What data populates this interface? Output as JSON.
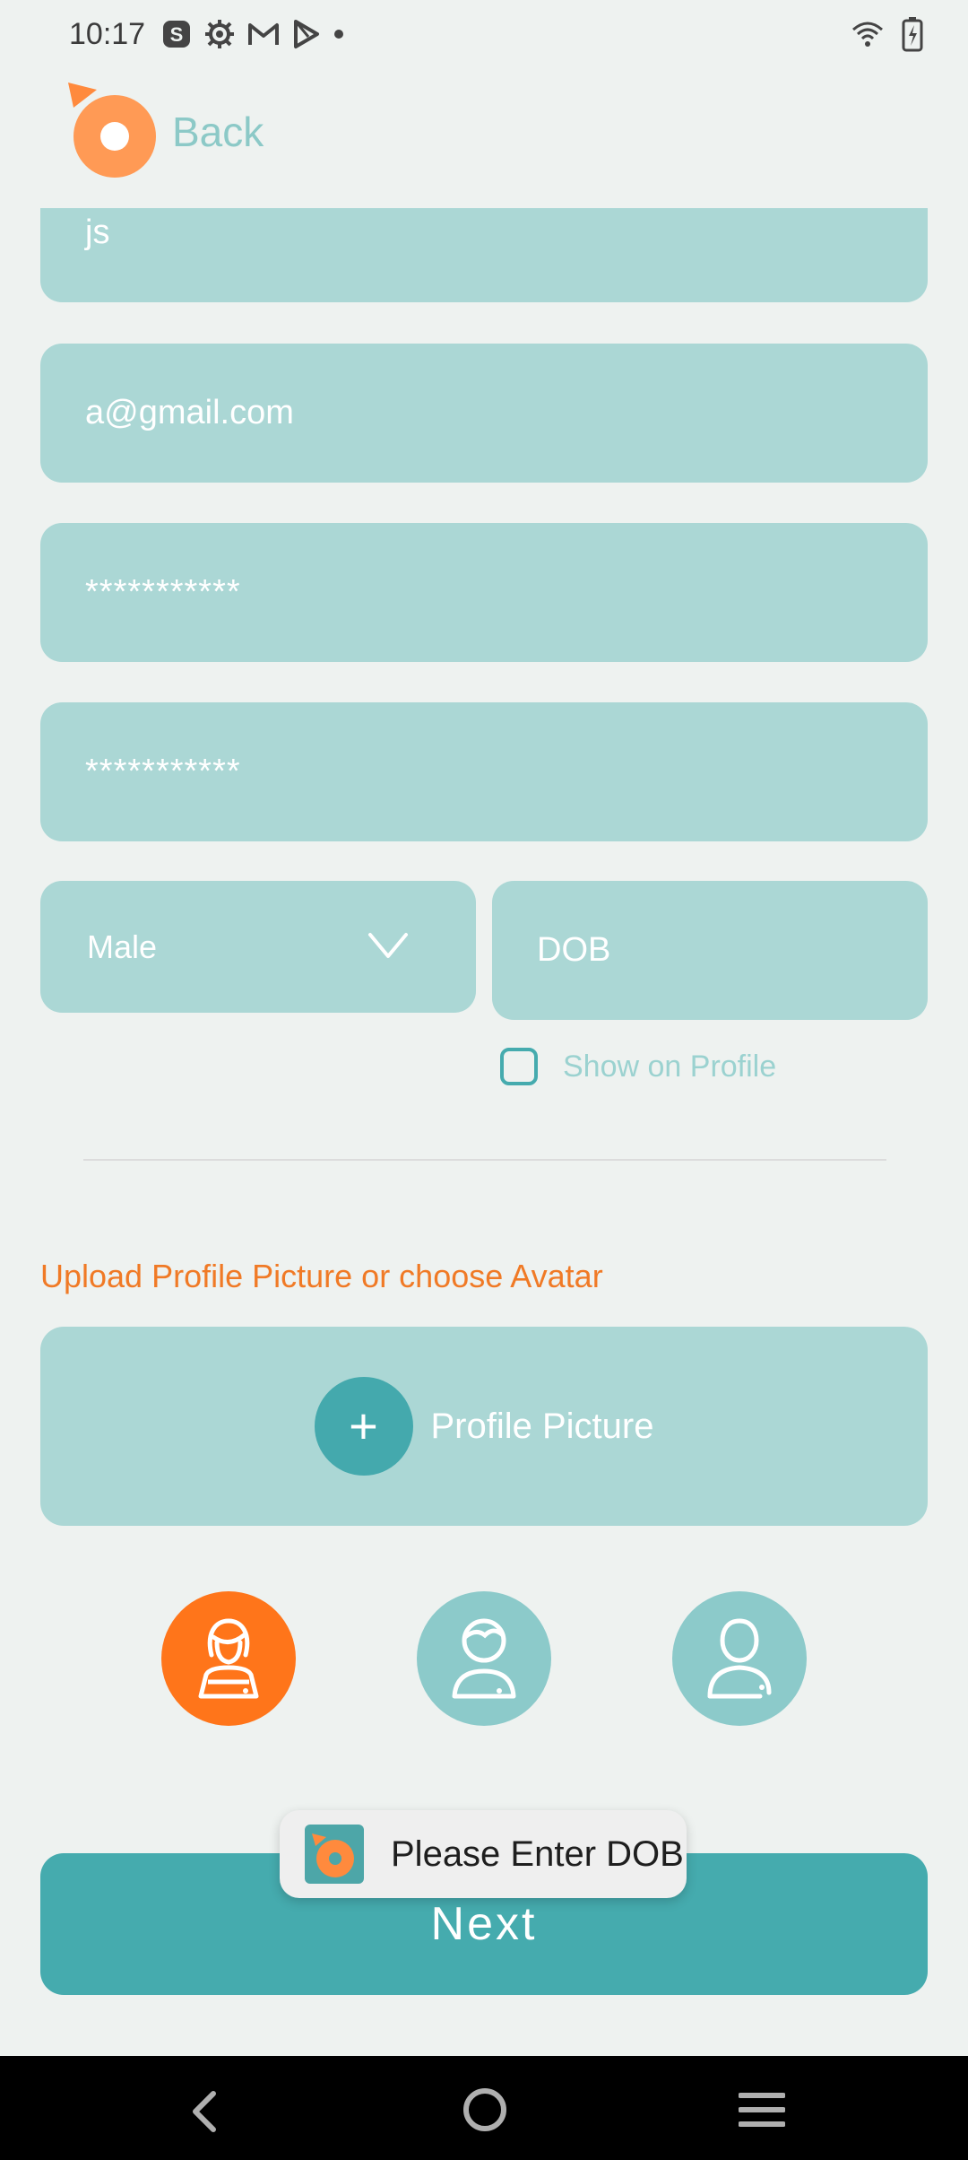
{
  "status_bar": {
    "time": "10:17",
    "left_icons": [
      "s-app-icon",
      "settings-icon",
      "gmail-icon",
      "play-store-icon",
      "dot-icon"
    ],
    "right_icons": [
      "wifi-icon",
      "battery-charging-icon"
    ]
  },
  "header": {
    "back_label": "Back",
    "logo": "app-logo-icon"
  },
  "form": {
    "name_value": "js",
    "email_value": "a@gmail.com",
    "password_value": "***********",
    "confirm_password_value": "***********",
    "gender_value": "Male",
    "dob_placeholder": "DOB",
    "show_on_profile_label": "Show on Profile",
    "show_on_profile_checked": false
  },
  "upload": {
    "title": "Upload Profile Picture or choose Avatar",
    "profile_picture_label": "Profile Picture",
    "plus_symbol": "+",
    "avatars": [
      {
        "name": "female-avatar-icon",
        "selected": true
      },
      {
        "name": "male-avatar-icon",
        "selected": false
      },
      {
        "name": "neutral-avatar-icon",
        "selected": false
      }
    ]
  },
  "next_label": "Next",
  "toast": {
    "message": "Please Enter DOB"
  },
  "colors": {
    "field_bg": "#ABD7D5",
    "accent_teal": "#45ABAE",
    "accent_orange": "#FF751A",
    "upload_title": "#F07A26",
    "back_text": "#8CC9C7"
  },
  "nav_bar": [
    "nav-back-icon",
    "nav-home-icon",
    "nav-menu-icon"
  ]
}
